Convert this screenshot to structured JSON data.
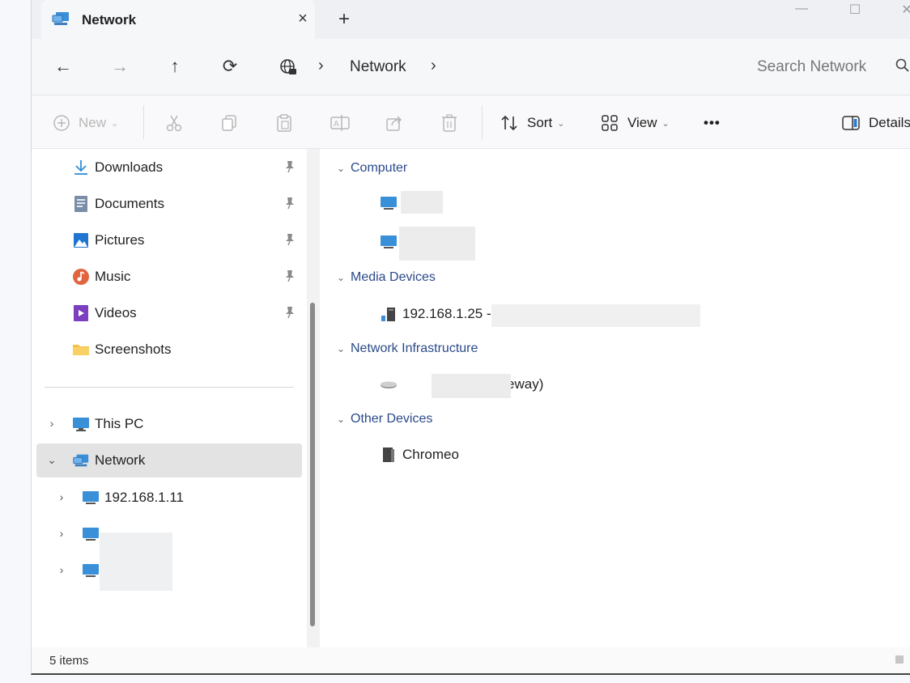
{
  "tab": {
    "title": "Network",
    "close": "×",
    "new_tab": "+"
  },
  "window_controls": {
    "minimize": "—",
    "maximize": "☐",
    "close": "✕"
  },
  "nav": {
    "back": "←",
    "forward": "→",
    "up": "↑",
    "refresh": "⟳"
  },
  "address": {
    "separator": "›",
    "crumb": "Network"
  },
  "search": {
    "placeholder": "Search Network"
  },
  "toolbar": {
    "new_label": "New",
    "sort_label": "Sort",
    "view_label": "View",
    "more_label": "•••",
    "details_label": "Details"
  },
  "sidebar": {
    "quick_access": [
      {
        "label": "Downloads",
        "icon": "download-icon",
        "pinned": true
      },
      {
        "label": "Documents",
        "icon": "documents-icon",
        "pinned": true
      },
      {
        "label": "Pictures",
        "icon": "pictures-icon",
        "pinned": true
      },
      {
        "label": "Music",
        "icon": "music-icon",
        "pinned": true
      },
      {
        "label": "Videos",
        "icon": "videos-icon",
        "pinned": true
      },
      {
        "label": "Screenshots",
        "icon": "folder-icon",
        "pinned": false
      }
    ],
    "this_pc": "This PC",
    "network": "Network",
    "network_children": [
      "192.168.1.11"
    ]
  },
  "content": {
    "groups": {
      "computer": "Computer",
      "media_devices": "Media Devices",
      "network_infrastructure": "Network Infrastructure",
      "other_devices": "Other Devices"
    },
    "media_device_label": "192.168.1.25 - :",
    "gateway_label": "(Gateway)",
    "other_device_label": "Chromeo"
  },
  "status": {
    "items_count": "5 items"
  },
  "colors": {
    "group_header": "#2b4a8a",
    "selection": "#e3e3e3",
    "accent": "#2e7bd6"
  }
}
